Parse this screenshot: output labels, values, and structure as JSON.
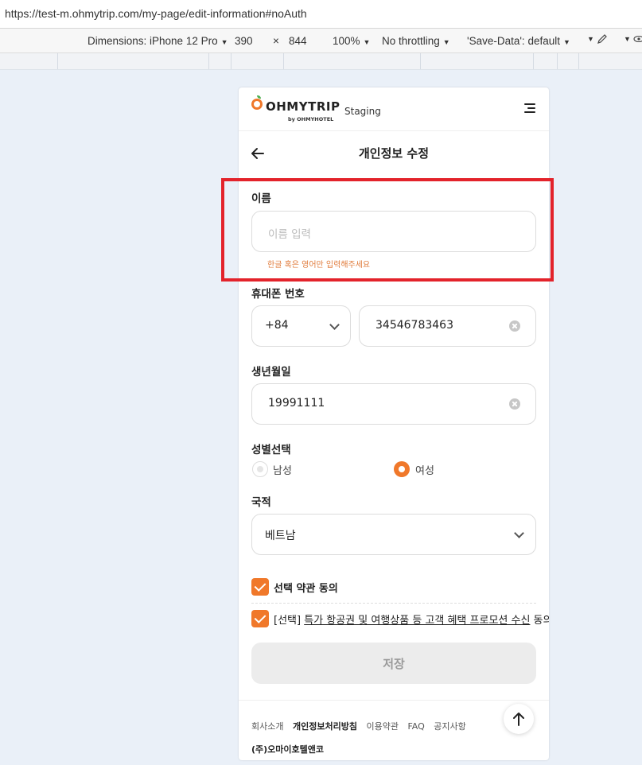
{
  "browser": {
    "url": "https://test-m.ohmytrip.com/my-page/edit-information#noAuth"
  },
  "devtools": {
    "dimensions_label": "Dimensions: iPhone 12 Pro",
    "width": "390",
    "times": "×",
    "height": "844",
    "zoom": "100%",
    "throttling": "No throttling",
    "save_data": "'Save-Data': default"
  },
  "header": {
    "logo_text": "OHMYTRIP",
    "logo_sub": "by OHMYHOTEL",
    "staging": "Staging"
  },
  "page": {
    "title": "개인정보 수정"
  },
  "form": {
    "name": {
      "label": "이름",
      "placeholder": "이름 입력",
      "error": "한글 혹은 영어만 입력해주세요"
    },
    "phone": {
      "label": "휴대폰 번호",
      "country_code": "+84",
      "number": "34546783463"
    },
    "birthdate": {
      "label": "생년월일",
      "value": "19991111"
    },
    "gender": {
      "label": "성별선택",
      "options": [
        "남성",
        "여성"
      ],
      "selected": "여성"
    },
    "nationality": {
      "label": "국적",
      "value": "베트남"
    },
    "consent": {
      "all_label": "선택 약관 동의",
      "item_prefix": "[선택] ",
      "item_link": "특가 항공권 및 여행상품 등 고객 혜택 프로모션 수신",
      "item_suffix": " 동의"
    },
    "save_label": "저장"
  },
  "footer": {
    "links": [
      "회사소개",
      "개인정보처리방침",
      "이용약관",
      "FAQ",
      "공지사항"
    ],
    "company": "(주)오마이호텔앤코"
  },
  "colors": {
    "accent": "#f0782a",
    "error": "#e07b3b",
    "highlight": "#e3232b"
  }
}
